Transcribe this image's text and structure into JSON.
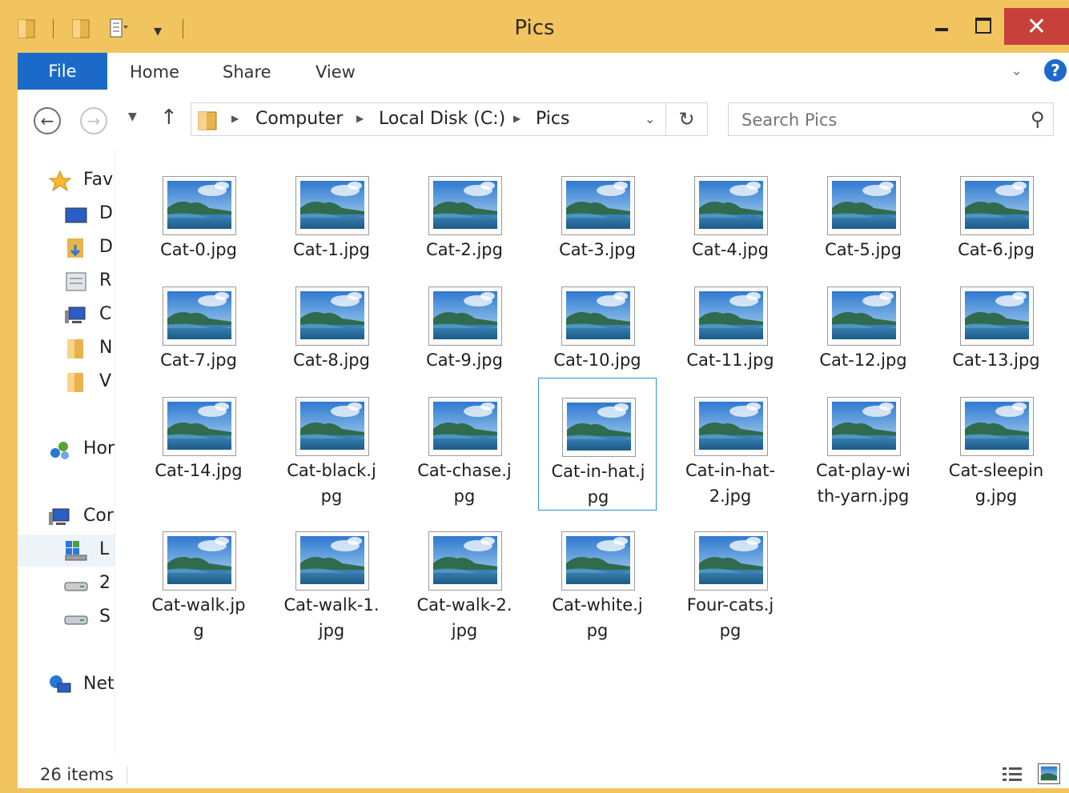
{
  "window": {
    "title": "Pics"
  },
  "ribbon": {
    "tabs": [
      "File",
      "Home",
      "Share",
      "View"
    ]
  },
  "address": {
    "crumbs": [
      "Computer",
      "Local Disk (C:)",
      "Pics"
    ],
    "search_placeholder": "Search Pics"
  },
  "nav": {
    "items": [
      "Fav",
      "D",
      "D",
      "R",
      "C",
      "N",
      "V",
      "Hor",
      "Cor",
      "L",
      "2",
      "S",
      "Net"
    ]
  },
  "files": [
    {
      "line1": "Cat-0.jpg",
      "line2": ""
    },
    {
      "line1": "Cat-1.jpg",
      "line2": ""
    },
    {
      "line1": "Cat-2.jpg",
      "line2": ""
    },
    {
      "line1": "Cat-3.jpg",
      "line2": ""
    },
    {
      "line1": "Cat-4.jpg",
      "line2": ""
    },
    {
      "line1": "Cat-5.jpg",
      "line2": ""
    },
    {
      "line1": "Cat-6.jpg",
      "line2": ""
    },
    {
      "line1": "Cat-7.jpg",
      "line2": ""
    },
    {
      "line1": "Cat-8.jpg",
      "line2": ""
    },
    {
      "line1": "Cat-9.jpg",
      "line2": ""
    },
    {
      "line1": "Cat-10.jpg",
      "line2": ""
    },
    {
      "line1": "Cat-11.jpg",
      "line2": ""
    },
    {
      "line1": "Cat-12.jpg",
      "line2": ""
    },
    {
      "line1": "Cat-13.jpg",
      "line2": ""
    },
    {
      "line1": "Cat-14.jpg",
      "line2": ""
    },
    {
      "line1": "Cat-black.j",
      "line2": "pg"
    },
    {
      "line1": "Cat-chase.j",
      "line2": "pg"
    },
    {
      "line1": "Cat-in-hat.j",
      "line2": "pg"
    },
    {
      "line1": "Cat-in-hat-",
      "line2": "2.jpg"
    },
    {
      "line1": "Cat-play-wi",
      "line2": "th-yarn.jpg"
    },
    {
      "line1": "Cat-sleepin",
      "line2": "g.jpg"
    },
    {
      "line1": "Cat-walk.jp",
      "line2": "g"
    },
    {
      "line1": "Cat-walk-1.",
      "line2": "jpg"
    },
    {
      "line1": "Cat-walk-2.",
      "line2": "jpg"
    },
    {
      "line1": "Cat-white.j",
      "line2": "pg"
    },
    {
      "line1": "Four-cats.j",
      "line2": "pg"
    }
  ],
  "status": {
    "count": "26 items"
  }
}
